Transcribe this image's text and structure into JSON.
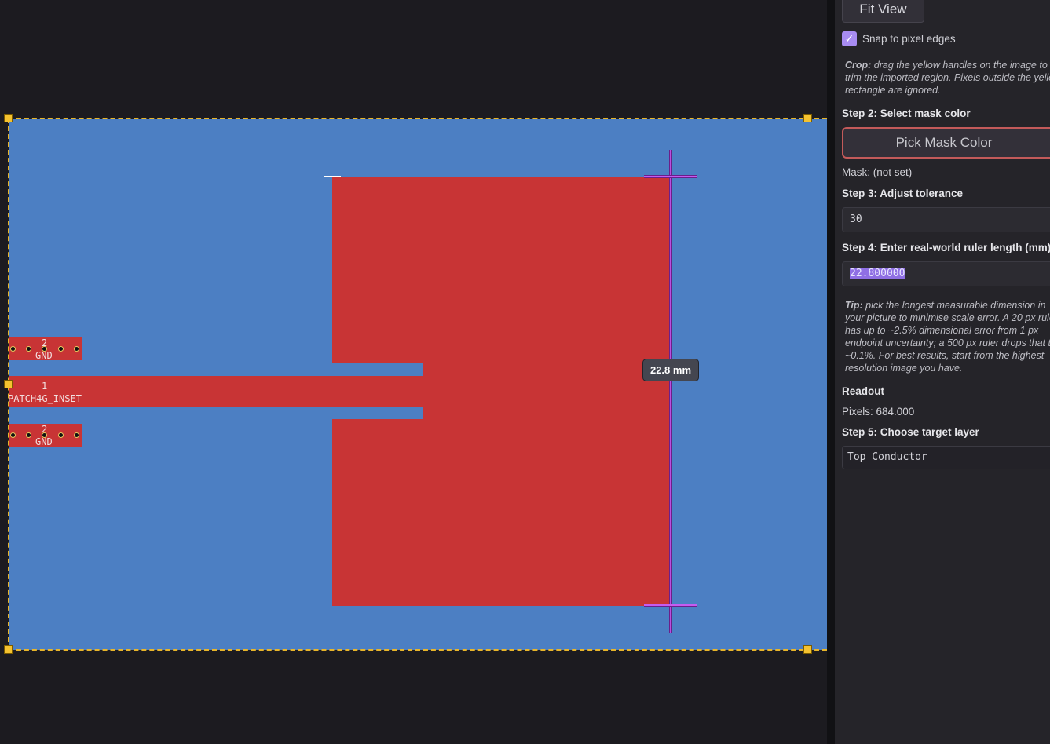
{
  "canvas": {
    "colors": {
      "board": "#4c7fc3",
      "copper": "#c83435",
      "crop": "#e8b52a",
      "ruler": "#b84fe0"
    },
    "pads": [
      {
        "number": "2",
        "name": "GND"
      },
      {
        "number": "1",
        "name": "PATCH4G_INSET"
      },
      {
        "number": "2",
        "name": "GND"
      }
    ],
    "ruler_label": "22.8 mm"
  },
  "panel": {
    "fit_view_label": "Fit View",
    "snap_checked": true,
    "snap_label": "Snap to pixel edges",
    "crop_title": "Crop:",
    "crop_text": " drag the yellow handles on the image to trim the imported region. Pixels outside the yellow rectangle are ignored.",
    "step2_label": "Step 2: Select mask color",
    "pick_mask_label": "Pick Mask Color",
    "mask_status": "Mask: (not set)",
    "step3_label": "Step 3: Adjust tolerance",
    "tolerance_value": "30",
    "step4_label": "Step 4: Enter real-world ruler length (mm)",
    "ruler_length_value": "22.800000",
    "tip_title": "Tip:",
    "tip_text": " pick the longest measurable dimension in your picture to minimise scale error. A 20 px ruler has up to ~2.5% dimensional error from 1 px endpoint uncertainty; a 500 px ruler drops that to ~0.1%. For best results, start from the highest-resolution image you have.",
    "readout_label": "Readout",
    "pixels_readout": "Pixels: 684.000",
    "step5_label": "Step 5: Choose target layer",
    "target_layer": "Top Conductor"
  }
}
